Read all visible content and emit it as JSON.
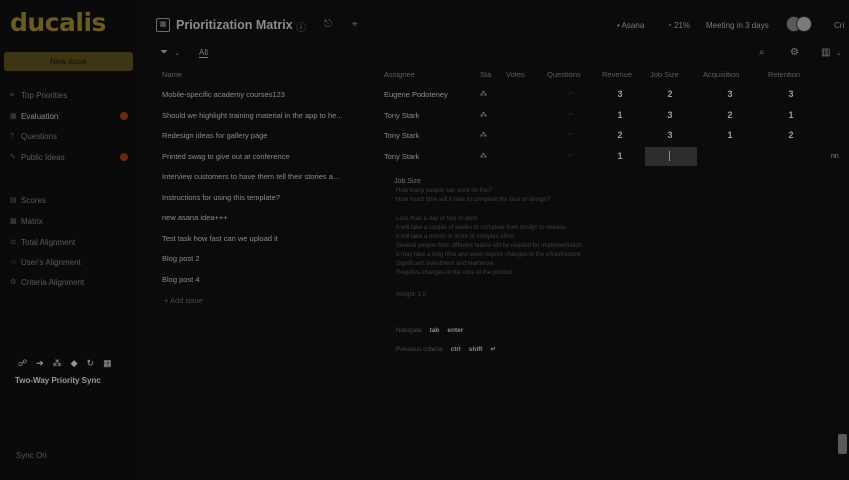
{
  "sidebar": {
    "logo": "ducalis",
    "new_issue": "New issue",
    "items": [
      {
        "label": "Top Priorities",
        "icon": "list-icon",
        "active": false,
        "badge": false
      },
      {
        "label": "Evaluation",
        "icon": "grid-icon",
        "active": true,
        "badge": true
      },
      {
        "label": "Questions",
        "icon": "question-icon",
        "active": false,
        "badge": false
      },
      {
        "label": "Public Ideas",
        "icon": "bulb-icon",
        "active": false,
        "badge": true
      },
      {
        "label": "Scores",
        "icon": "chart-icon",
        "active": false,
        "badge": false
      },
      {
        "label": "Matrix",
        "icon": "matrix-icon",
        "active": false,
        "badge": false
      },
      {
        "label": "Total Alignment",
        "icon": "align-icon",
        "active": false,
        "badge": false
      },
      {
        "label": "User's Alignment",
        "icon": "user-icon",
        "active": false,
        "badge": false
      },
      {
        "label": "Criteria Alignment",
        "icon": "criteria-icon",
        "active": false,
        "badge": false
      }
    ],
    "sync_icons": [
      "github-icon",
      "arrow-icon",
      "network-icon",
      "diamond-icon",
      "sync-icon",
      "grid-icon"
    ],
    "sync_title": "Two-Way Priority Sync",
    "sync_status": "Sync On"
  },
  "header": {
    "title": "Prioritization Matrix",
    "integration": "Asana",
    "progress": "21%",
    "meeting": "Meeting in 3 days",
    "user_short": "Cri"
  },
  "toolbar": {
    "filter_label": "All"
  },
  "table": {
    "columns": [
      "Name",
      "Assignee",
      "Sta",
      "Votes",
      "Questions",
      "Revenue",
      "Job Size",
      "Acquisition",
      "Retention"
    ],
    "rows": [
      {
        "name": "Mobile-specific academy courses123",
        "assignee": "Eugene Podoteney",
        "revenue": "3",
        "job_size": "2",
        "acquisition": "3",
        "retention": "3"
      },
      {
        "name": "Should we highlight training material in the app to he...",
        "assignee": "Tony Stark",
        "revenue": "1",
        "job_size": "3",
        "acquisition": "2",
        "retention": "1"
      },
      {
        "name": "Redesign ideas for gallery page",
        "assignee": "Tony Stark",
        "revenue": "2",
        "job_size": "3",
        "acquisition": "1",
        "retention": "2"
      },
      {
        "name": "Printed swag to give out at conference",
        "assignee": "Tony Stark",
        "revenue": "1",
        "job_size": "",
        "acquisition": "",
        "retention": ""
      },
      {
        "name": "Interview customers to have them tell their stories a...",
        "assignee": "",
        "revenue": "",
        "job_size": "",
        "acquisition": "",
        "retention": ""
      },
      {
        "name": "Instructions for using this template?",
        "assignee": "",
        "revenue": "",
        "job_size": "",
        "acquisition": "",
        "retention": ""
      },
      {
        "name": "new asana idea+++",
        "assignee": "",
        "revenue": "",
        "job_size": "",
        "acquisition": "",
        "retention": ""
      },
      {
        "name": "Test task how fast can we upload it",
        "assignee": "",
        "revenue": "",
        "job_size": "",
        "acquisition": "",
        "retention": ""
      },
      {
        "name": "Blog post 2",
        "assignee": "",
        "revenue": "",
        "job_size": "",
        "acquisition": "",
        "retention": ""
      },
      {
        "name": "Blog post 4",
        "assignee": "",
        "revenue": "",
        "job_size": "",
        "acquisition": "",
        "retention": ""
      }
    ],
    "add_issue": "+ Add issue",
    "row_suffix": "nn"
  },
  "tooltip": {
    "title": "Job Size",
    "lines": [
      "How many people can work on this?",
      "How much time will it take to complete the task or design?",
      "",
      "Less than a day or two of work",
      "It will take a couple of weeks to complete from design to release",
      "It will take a month or more of complex effort",
      "Several people from different teams will be needed for implementation",
      "It may take a long time and even require changes to the infrastructure",
      "Significant investment and teamwork",
      "Requires changes to the core of the product"
    ],
    "weight": "Weight: 1.0",
    "navigate_label": "Navigate",
    "navigate_keys": "tab",
    "navigate_keys2": "enter",
    "previous_label": "Previous criteria",
    "previous_keys": "ctrl",
    "previous_keys2": "shift"
  }
}
